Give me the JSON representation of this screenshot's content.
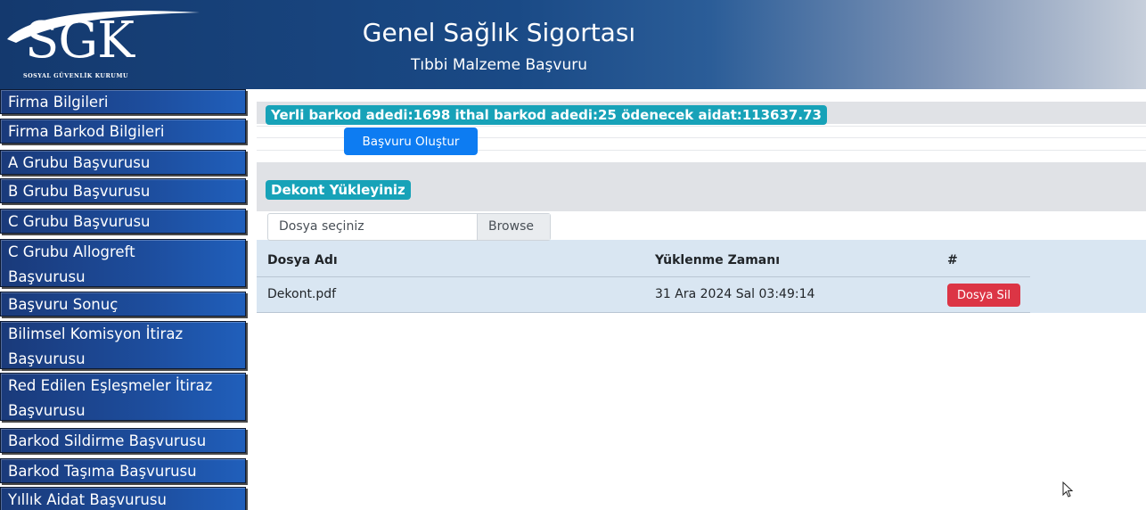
{
  "header": {
    "logo_text": "SGK",
    "logo_subtext": "SOSYAL GÜVENLİK KURUMU",
    "title": "Genel Sağlık Sigortası",
    "subtitle": "Tıbbi Malzeme Başvuru"
  },
  "sidebar": {
    "items": [
      {
        "label": "Firma Bilgileri"
      },
      {
        "label": "Firma Barkod Bilgileri"
      },
      {
        "label": "A Grubu Başvurusu"
      },
      {
        "label": "B Grubu Başvurusu"
      },
      {
        "label": "C Grubu Başvurusu"
      },
      {
        "label": "C Grubu Allogreft Başvurusu"
      },
      {
        "label": "Başvuru Sonuç"
      },
      {
        "label": "Bilimsel Komisyon İtiraz Başvurusu"
      },
      {
        "label": "Red Edilen Eşleşmeler İtiraz Başvurusu"
      },
      {
        "label": "Barkod Sildirme Başvurusu"
      },
      {
        "label": "Barkod Taşıma Başvurusu"
      },
      {
        "label": "Yıllık Aidat Başvurusu"
      }
    ]
  },
  "main": {
    "summary_badge": "Yerli barkod adedi:1698 ithal barkod adedi:25 ödenecek aidat:113637.73",
    "create_button": "Başvuru Oluştur",
    "upload_title": "Dekont Yükleyiniz",
    "file_input": {
      "placeholder": "Dosya seçiniz",
      "browse_label": "Browse"
    },
    "table": {
      "columns": [
        "Dosya Adı",
        "Yüklenme Zamanı",
        "#"
      ],
      "rows": [
        {
          "file_name": "Dekont.pdf",
          "uploaded_at": "31 Ara 2024 Sal 03:49:14",
          "action_label": "Dosya Sil"
        }
      ]
    }
  },
  "colors": {
    "header_dark": "#14396e",
    "sidebar_blue": "#1d4d9d",
    "badge_teal": "#17a2b8",
    "primary_button": "#0d7cf2",
    "danger_button": "#dc3545",
    "table_band": "#d9e6f2"
  },
  "icons": {
    "cursor": "mouse-pointer-icon"
  }
}
